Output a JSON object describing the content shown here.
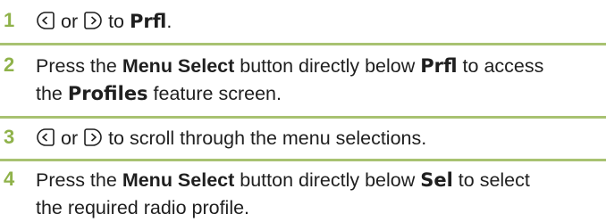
{
  "steps": [
    {
      "number": "1",
      "or": "or",
      "to": "to",
      "display": "Prfl",
      "end": "."
    },
    {
      "number": "2",
      "pre": "Press the",
      "button": "Menu Select",
      "mid": "button directly below",
      "display": "Prfl",
      "post": "to access",
      "line2_pre": "the",
      "display2": "Profiles",
      "line2_post": "feature screen."
    },
    {
      "number": "3",
      "or": "or",
      "post": "to scroll through the menu selections."
    },
    {
      "number": "4",
      "pre": "Press the",
      "button": "Menu Select",
      "mid": "button directly below",
      "display": "Sel",
      "post": "to select",
      "line2": "the required radio profile."
    }
  ],
  "icons": {
    "left": "left-navigation-button-icon",
    "right": "right-navigation-button-icon"
  },
  "colors": {
    "step_number": "#8fb24a",
    "rule": "#a8c271",
    "text": "#1f1f1f"
  }
}
